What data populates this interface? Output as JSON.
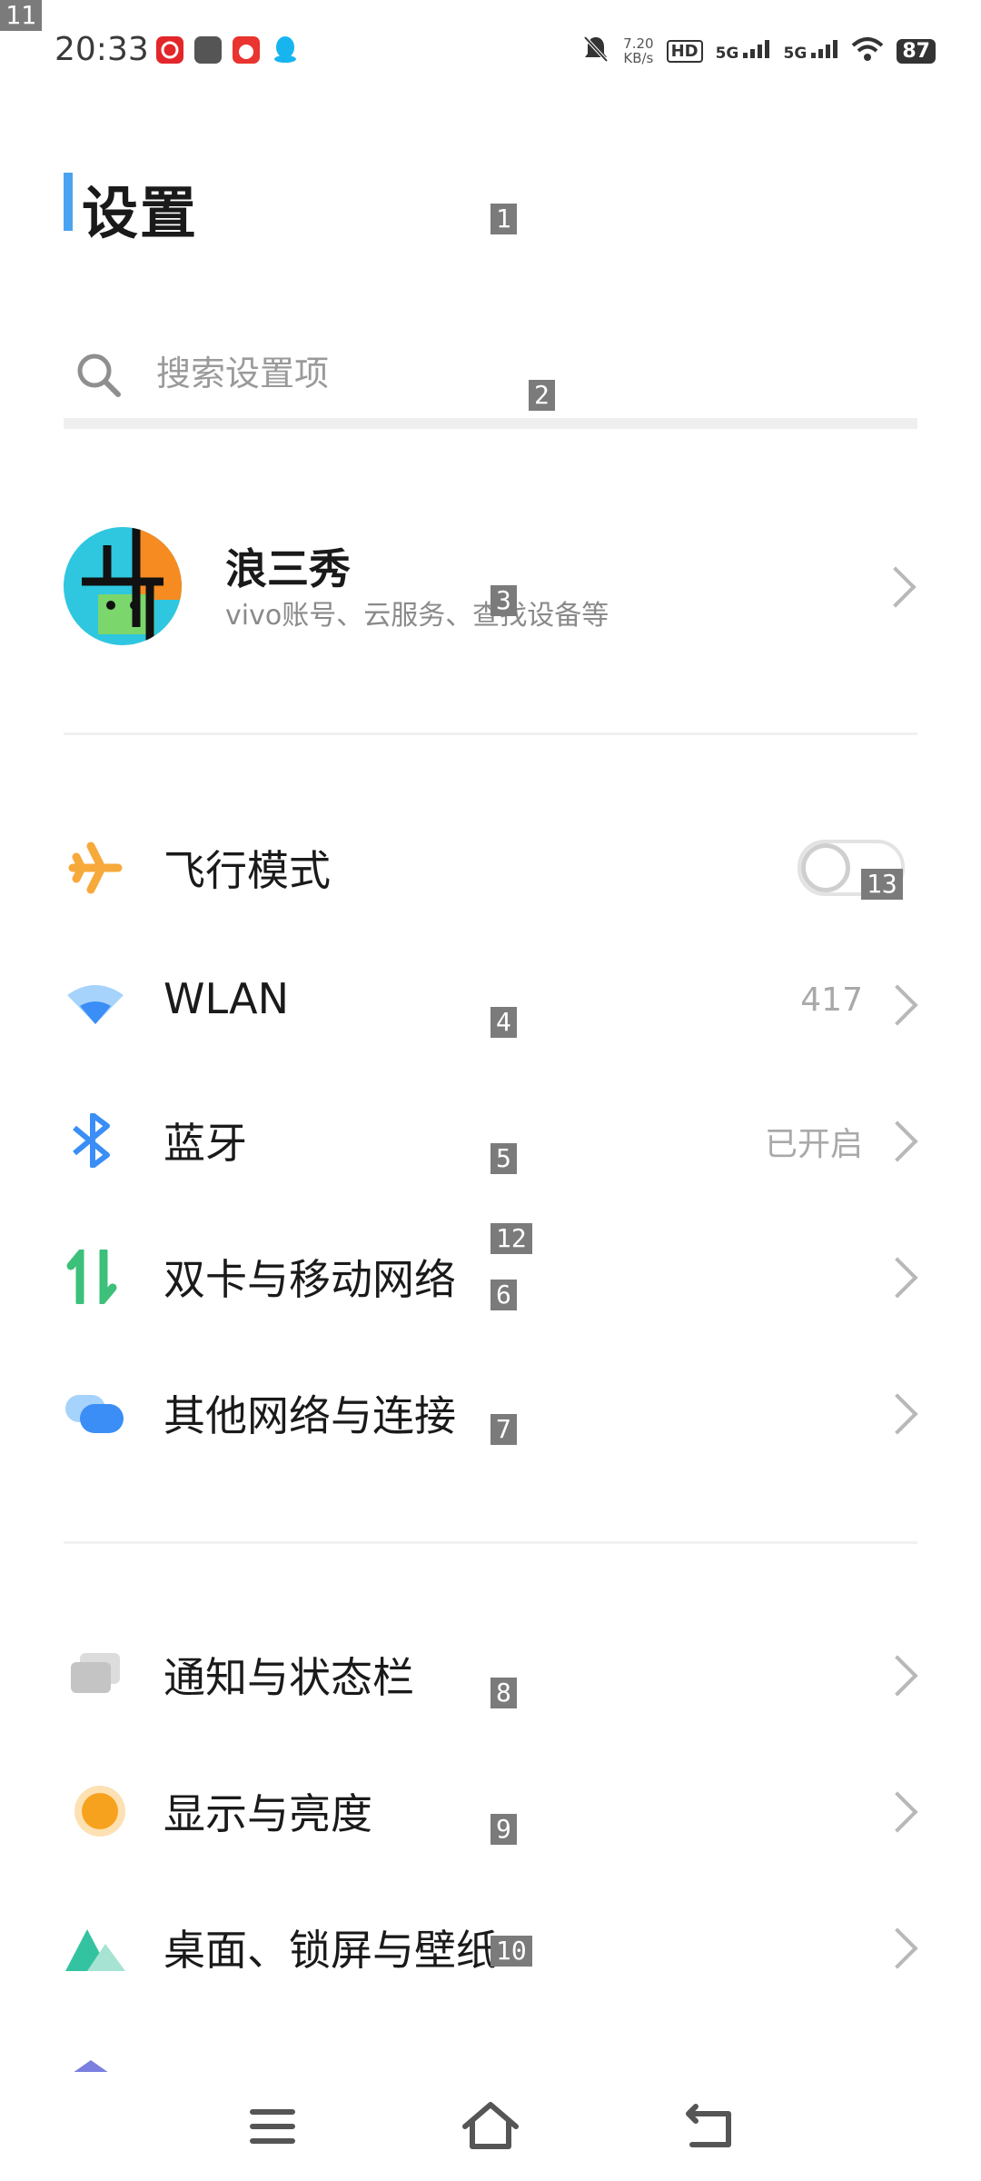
{
  "status_bar": {
    "time": "20:33",
    "net_speed_value": "7.20",
    "net_speed_unit": "KB/s",
    "hd_label": "HD",
    "sim1_label": "5G",
    "sim2_label": "5G",
    "battery": "87",
    "icons": [
      "netease-music-icon",
      "app-square-icon",
      "red-app-icon",
      "qq-icon",
      "mute-bell-icon",
      "wifi-icon",
      "battery-icon"
    ]
  },
  "page": {
    "title": "设置",
    "search_placeholder": "搜索设置项"
  },
  "profile": {
    "name": "浪三秀",
    "description": "vivo账号、云服务、查找设备等"
  },
  "group1": [
    {
      "id": "airplane",
      "label": "飞行模式",
      "icon": "airplane-icon",
      "toggle": false
    },
    {
      "id": "wlan",
      "label": "WLAN",
      "value": "417",
      "icon": "wifi-icon"
    },
    {
      "id": "bluetooth",
      "label": "蓝牙",
      "value": "已开启",
      "icon": "bluetooth-icon"
    },
    {
      "id": "sim",
      "label": "双卡与移动网络",
      "icon": "dual-sim-icon"
    },
    {
      "id": "other-net",
      "label": "其他网络与连接",
      "icon": "connection-bubbles-icon"
    }
  ],
  "group2": [
    {
      "id": "notify",
      "label": "通知与状态栏",
      "icon": "notification-icon"
    },
    {
      "id": "display",
      "label": "显示与亮度",
      "icon": "brightness-icon"
    },
    {
      "id": "desktop",
      "label": "桌面、锁屏与壁纸",
      "icon": "wallpaper-icon"
    }
  ],
  "overlay_badges": [
    "1",
    "2",
    "3",
    "4",
    "5",
    "6",
    "7",
    "8",
    "9",
    "10",
    "11",
    "12",
    "13"
  ],
  "colors": {
    "title_accent": "#4aa3f0",
    "airplane": "#f7a93b",
    "wifi": "#3a8ef6",
    "bluetooth": "#3a8ef6",
    "sim": "#3cc07a",
    "display": "#f7a21e",
    "wallpaper": "#34c3a0"
  }
}
